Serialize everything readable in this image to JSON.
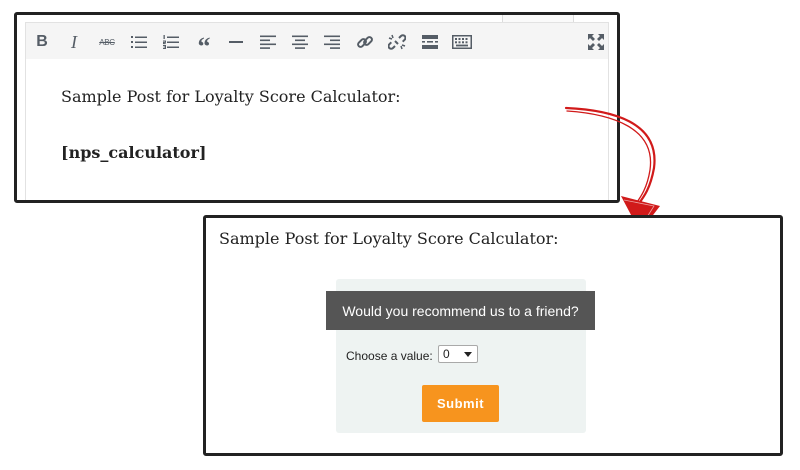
{
  "editor": {
    "toolbar": {
      "bold_label": "B",
      "italic_label": "I",
      "strikethrough_label": "ABC",
      "blockquote_label": "“",
      "icons": [
        "bold-icon",
        "italic-icon",
        "strikethrough-icon",
        "bullet-list-icon",
        "numbered-list-icon",
        "blockquote-icon",
        "horizontal-line-icon",
        "align-left-icon",
        "align-center-icon",
        "align-right-icon",
        "insert-link-icon",
        "remove-link-icon",
        "read-more-icon",
        "toolbar-toggle-icon",
        "fullscreen-icon"
      ]
    },
    "content": {
      "line1": "Sample Post for Loyalty Score Calculator:",
      "line2": "[nps_calculator]"
    }
  },
  "arrow": {
    "color": "#d11a1a"
  },
  "preview": {
    "title": "Sample Post for Loyalty Score Calculator:",
    "widget": {
      "header": "Would you recommend us to a friend?",
      "choose_label": "Choose a value:",
      "selected_value": "0",
      "submit_label": "Submit",
      "colors": {
        "header_bg": "#555555",
        "submit_bg": "#f7941e",
        "widget_bg": "#eef3f2"
      }
    }
  }
}
